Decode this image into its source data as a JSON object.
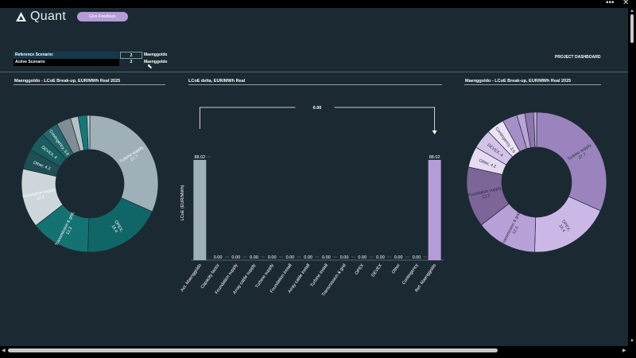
{
  "window": {
    "more_icon": "more-icon",
    "close_icon": "close-icon"
  },
  "header": {
    "logo_text": "Quant",
    "feedback_label": "Give Feedback",
    "project_dashboard": "PROJECT DASHBOARD"
  },
  "scenarios": [
    {
      "label": "Reference Scenario:",
      "value": "2",
      "name": "Maenggoldo"
    },
    {
      "label": "Active Scenario",
      "value": "2",
      "name": "Maenggoldo"
    }
  ],
  "colors": {
    "bg": "#1b2a32",
    "teal": "#0e6b6b",
    "purple": "#b69bd9"
  },
  "chart_data": [
    {
      "type": "pie",
      "title": "Maenggoldo - LCoE Break-up, EUR/MWh Real 2025",
      "slices": [
        {
          "label": "Turbine supply, 27.7",
          "value": 27.7,
          "color": "#a0b0b8"
        },
        {
          "label": "OPEX, 16.4",
          "value": 16.4,
          "color": "#106666"
        },
        {
          "label": "Transmission & grid, 12.3",
          "value": 12.3,
          "color": "#157272"
        },
        {
          "label": "Foundation supply, 12.2",
          "value": 12.2,
          "color": "#cdd7db"
        },
        {
          "label": "Other, 4.2",
          "value": 4.2,
          "color": "#1d4f54"
        },
        {
          "label": "DEVEX, 4",
          "value": 4.0,
          "color": "#185e60"
        },
        {
          "label": "Contingency, 3.6",
          "value": 3.6,
          "color": "#25666a"
        },
        {
          "label": "",
          "value": 3.0,
          "color": "#7f8e94"
        },
        {
          "label": "",
          "value": 1.6,
          "color": "#b4c2c7"
        },
        {
          "label": "",
          "value": 1.8,
          "color": "#137878"
        },
        {
          "label": "",
          "value": 0.6,
          "color": "#bac6cb"
        }
      ]
    },
    {
      "type": "bar",
      "title": "LCoE delta, EUR/MWh Real",
      "ylabel": "LCoE (EUR/MWh)",
      "categories": [
        "Act. Maenggoldo",
        "Capacity factor",
        "Foundation supply",
        "Array cable supply",
        "Turbine supply",
        "Foundation install",
        "Array cable install",
        "Turbine install",
        "Transmission & grid",
        "OPEX",
        "DEVEX",
        "Other",
        "Contingency",
        "Ref. Maenggoldo"
      ],
      "values": [
        88.02,
        0.0,
        0.0,
        0.0,
        0.0,
        0.0,
        0.0,
        0.0,
        0.0,
        0.0,
        0.0,
        0.0,
        0.0,
        88.02
      ],
      "labels": [
        "88.02",
        "0.00",
        "0.00",
        "0.00",
        "0.00",
        "0.00",
        "0.00",
        "0.00",
        "0.00",
        "0.00",
        "0.00",
        "0.00",
        "0.00",
        "88.02"
      ],
      "delta_label": "0.00",
      "ylim": [
        0,
        88.02
      ]
    },
    {
      "type": "pie",
      "title": "Maenggoldo - LCoE Break-up, EUR/MWh Real 2025",
      "slices": [
        {
          "label": "Turbine supply, 27.7",
          "value": 27.7,
          "color": "#9b84bd"
        },
        {
          "label": "OPEX, 16.4",
          "value": 16.4,
          "color": "#ccb8e6"
        },
        {
          "label": "Transmission & grid, 12.3",
          "value": 12.3,
          "color": "#b8a0d9"
        },
        {
          "label": "Foundation supply, 12.2",
          "value": 12.2,
          "color": "#7d6598"
        },
        {
          "label": "Other, 4.2",
          "value": 4.2,
          "color": "#e6dbf2"
        },
        {
          "label": "DEVEX, 4",
          "value": 4.0,
          "color": "#d3c3e8"
        },
        {
          "label": "Contingency, 3.6",
          "value": 3.6,
          "color": "#ebe3f5"
        },
        {
          "label": "",
          "value": 3.0,
          "color": "#a68fc6"
        },
        {
          "label": "",
          "value": 1.6,
          "color": "#b9a4d7"
        },
        {
          "label": "",
          "value": 1.8,
          "color": "#8e76ad"
        },
        {
          "label": "",
          "value": 0.6,
          "color": "#c4b0de"
        }
      ]
    }
  ]
}
